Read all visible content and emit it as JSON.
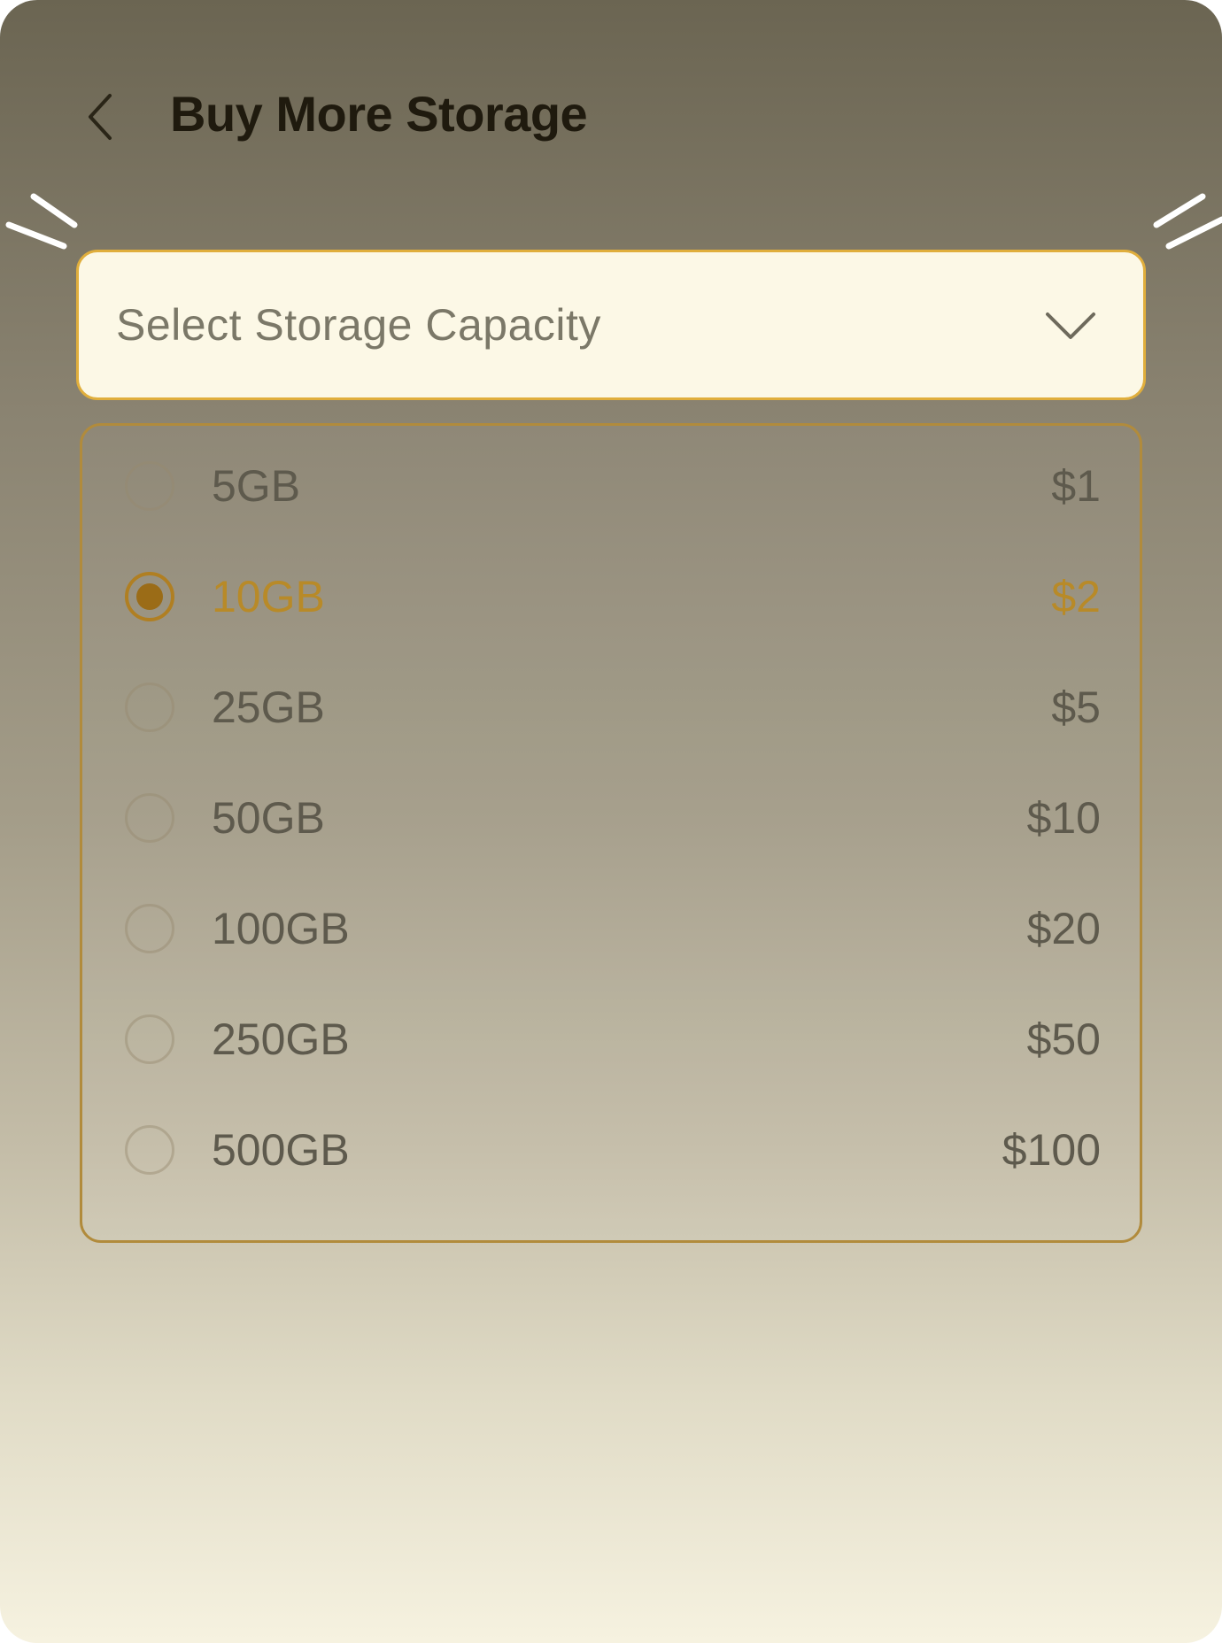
{
  "header": {
    "back_icon": "chevron-left-icon",
    "title": "Buy More Storage"
  },
  "select": {
    "placeholder": "Select Storage Capacity",
    "icon": "chevron-down-icon"
  },
  "options": [
    {
      "label": "5GB",
      "price": "$1",
      "selected": false
    },
    {
      "label": "10GB",
      "price": "$2",
      "selected": true
    },
    {
      "label": "25GB",
      "price": "$5",
      "selected": false
    },
    {
      "label": "50GB",
      "price": "$10",
      "selected": false
    },
    {
      "label": "100GB",
      "price": "$20",
      "selected": false
    },
    {
      "label": "250GB",
      "price": "$50",
      "selected": false
    },
    {
      "label": "500GB",
      "price": "$100",
      "selected": false
    }
  ],
  "colors": {
    "accent": "#e0ae3c",
    "selected_text": "#b88a28",
    "select_background": "#fcf8e6"
  }
}
